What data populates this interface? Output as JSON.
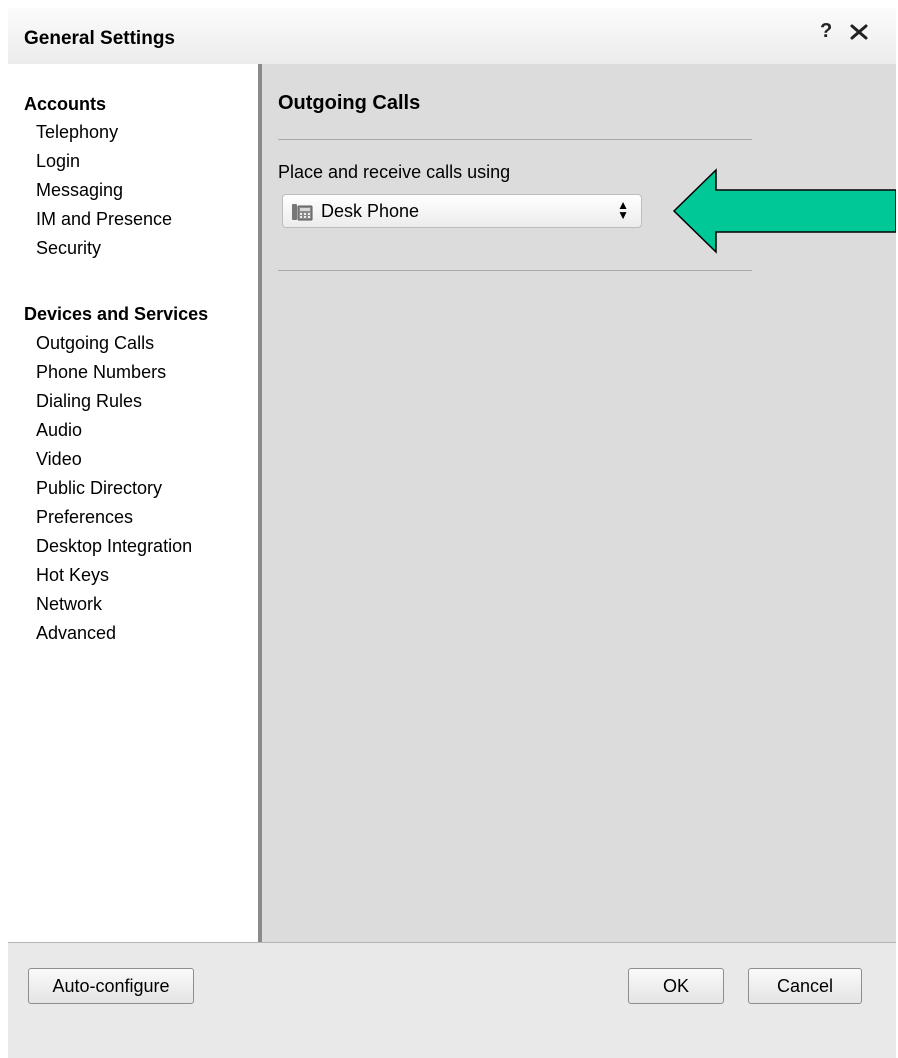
{
  "window": {
    "title": "General Settings",
    "help_label": "?",
    "close_icon": "close-icon"
  },
  "sidebar": {
    "groups": [
      {
        "title": "Accounts",
        "items": [
          "Telephony",
          "Login",
          "Messaging",
          "IM and Presence",
          "Security"
        ]
      },
      {
        "title": "Devices and Services",
        "items": [
          "Outgoing Calls",
          "Phone Numbers",
          "Dialing Rules",
          "Audio",
          "Video",
          "Public Directory",
          "Preferences",
          "Desktop Integration",
          "Hot Keys",
          "Network",
          "Advanced"
        ]
      }
    ]
  },
  "main": {
    "title": "Outgoing Calls",
    "field_label": "Place and receive calls using",
    "device_select": {
      "value": "Desk Phone",
      "icon": "desk-phone-icon"
    }
  },
  "annotation": {
    "arrow_color": "#00c896",
    "arrow_icon": "left-arrow-icon"
  },
  "footer": {
    "auto_configure_label": "Auto-configure",
    "ok_label": "OK",
    "cancel_label": "Cancel"
  },
  "colors": {
    "content_bg": "#dcdcdc",
    "sidebar_bg": "#ffffff",
    "footer_bg": "#e9e9e9"
  }
}
